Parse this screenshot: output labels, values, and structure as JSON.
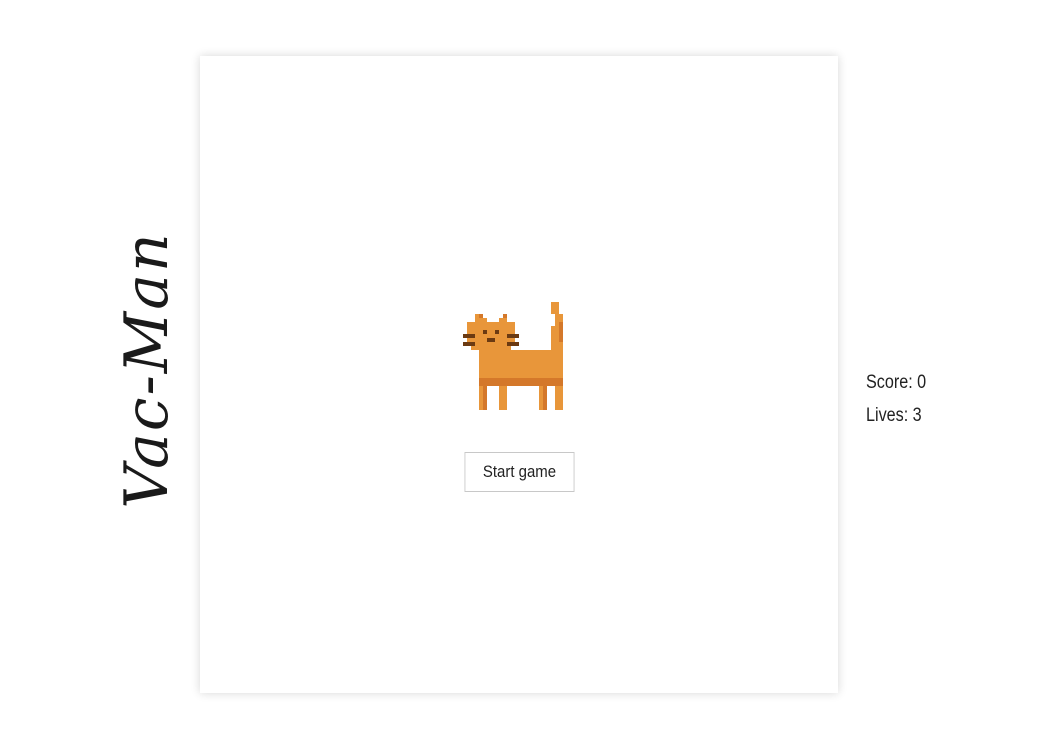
{
  "game": {
    "title": "Vac-Man",
    "start_button_label": "Start game"
  },
  "hud": {
    "score_label": "Score:",
    "score_value": "0",
    "lives_label": "Lives:",
    "lives_value": "3"
  },
  "sprite": {
    "name": "orange-pixel-cat",
    "colors": {
      "body": "#E8963A",
      "shade": "#D4782A",
      "dark": "#6B3A12"
    }
  }
}
